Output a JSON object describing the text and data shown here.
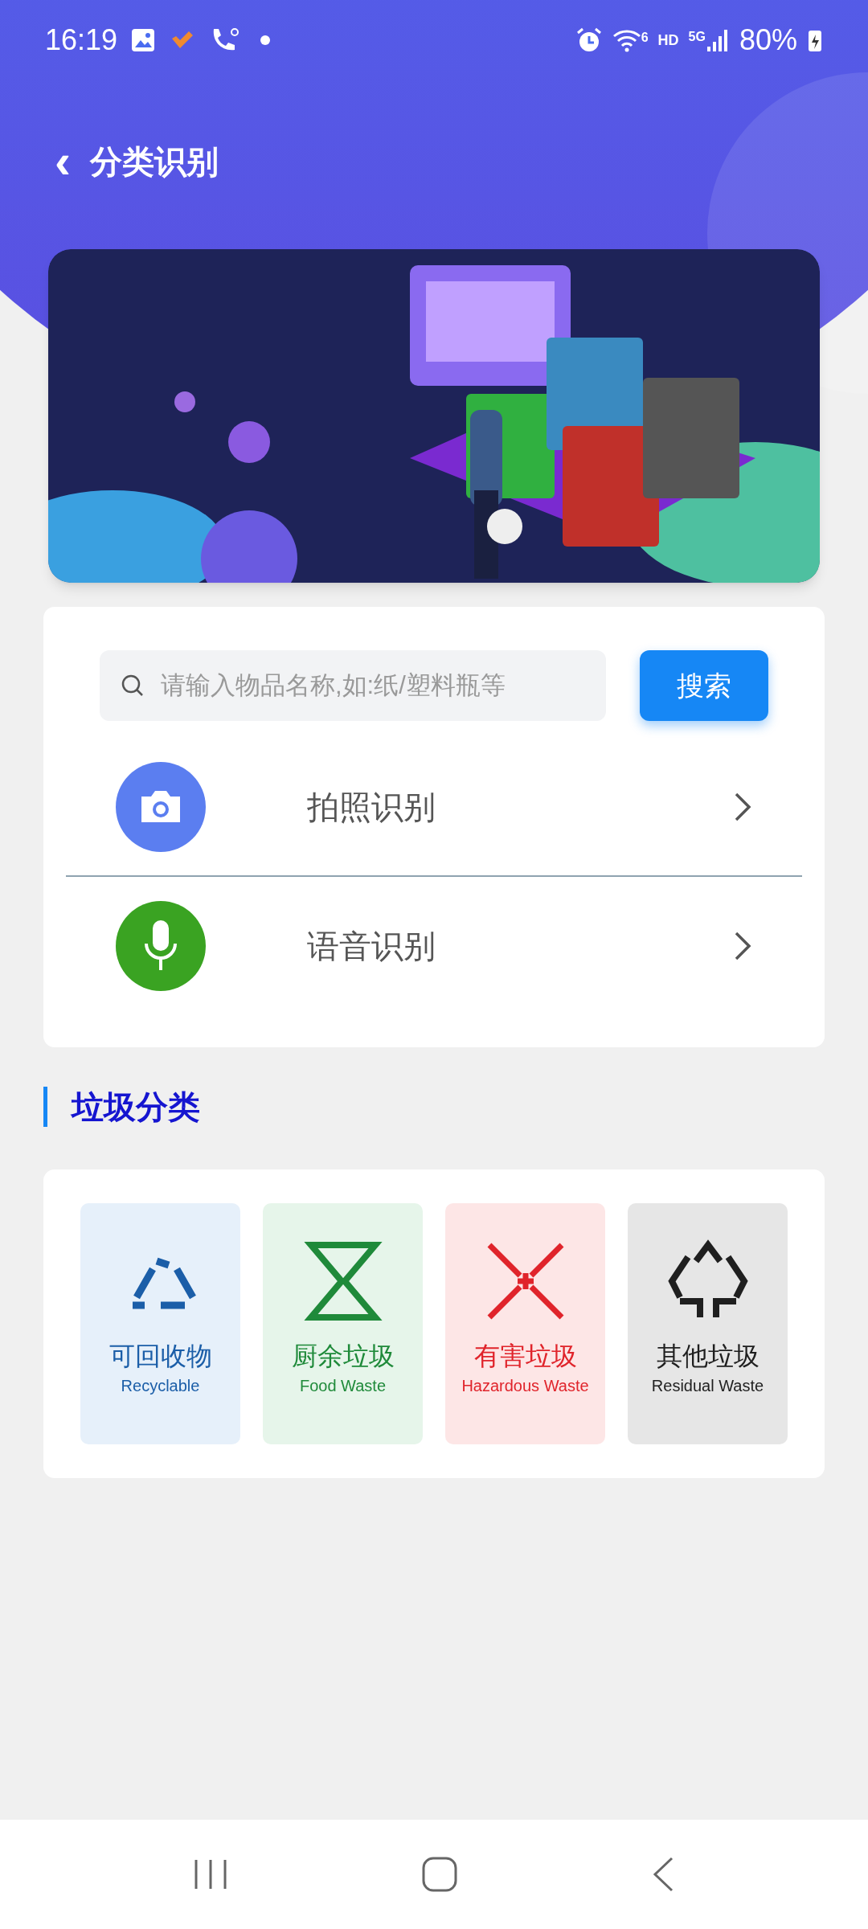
{
  "status_bar": {
    "time": "16:19",
    "battery": "80%",
    "network": "5G",
    "wifi_badge": "6",
    "hd": "HD"
  },
  "header": {
    "back": "‹",
    "title": "分类识别"
  },
  "search": {
    "placeholder": "请输入物品名称,如:纸/塑料瓶等",
    "button": "搜索"
  },
  "methods": [
    {
      "kind": "camera",
      "label": "拍照识别",
      "color": "#5b7ef0"
    },
    {
      "kind": "voice",
      "label": "语音识别",
      "color": "#3aa322"
    }
  ],
  "section": {
    "title": "垃圾分类"
  },
  "categories": [
    {
      "kind": "recyclable",
      "name": "可回收物",
      "english": "Recyclable",
      "color": "#1b5ea8"
    },
    {
      "kind": "food",
      "name": "厨余垃圾",
      "english": "Food Waste",
      "color": "#1f8a3a"
    },
    {
      "kind": "hazardous",
      "name": "有害垃圾",
      "english": "Hazardous Waste",
      "color": "#e0242b"
    },
    {
      "kind": "residual",
      "name": "其他垃圾",
      "english": "Residual Waste",
      "color": "#1f1f1f"
    }
  ]
}
